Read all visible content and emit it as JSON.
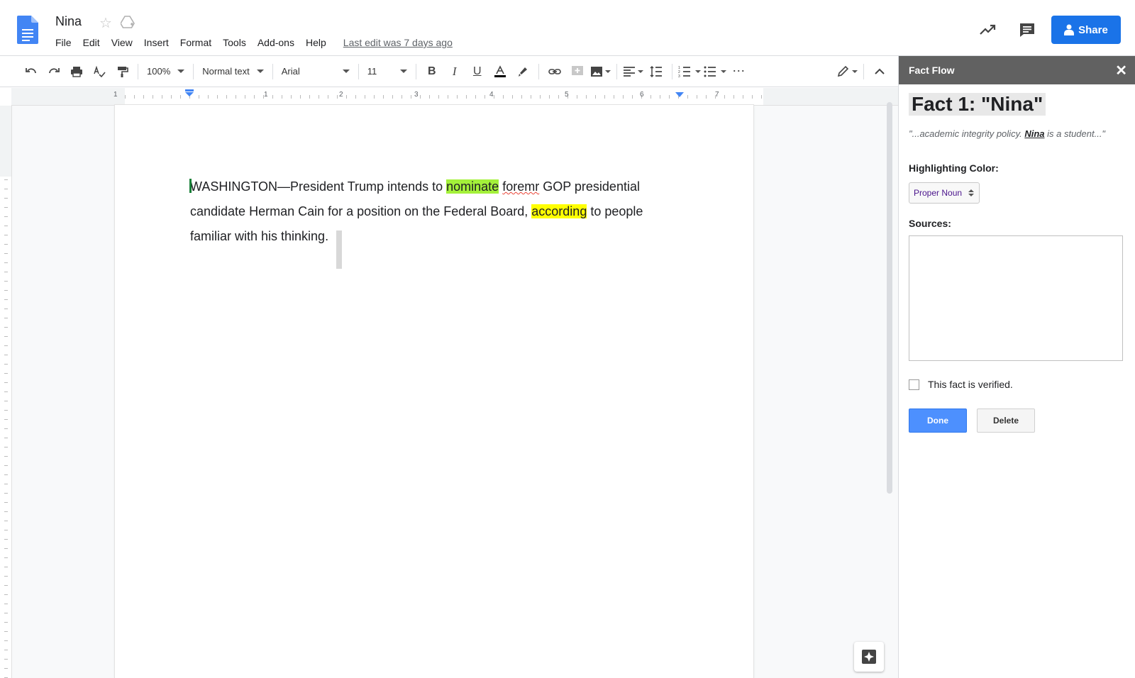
{
  "header": {
    "title": "Nina",
    "menu": [
      "File",
      "Edit",
      "View",
      "Insert",
      "Format",
      "Tools",
      "Add-ons",
      "Help"
    ],
    "last_edit": "Last edit was 7 days ago",
    "share_label": "Share"
  },
  "toolbar": {
    "zoom": "100%",
    "style": "Normal text",
    "font": "Arial",
    "size": "11"
  },
  "ruler": {
    "numbers": [
      "1",
      "1",
      "2",
      "3",
      "4",
      "5",
      "6",
      "7"
    ]
  },
  "document": {
    "p1": "WASHINGTON—President Trump intends to ",
    "hl1": "nominate",
    "p2": " ",
    "misspelled": "foremr",
    "p3": " GOP presidential candidate Herman Cain for a position on the Federal Board, ",
    "hl2": "according",
    "p4": " to people familiar with his thinking.",
    "hl1_color": "#a4f13a",
    "hl2_color": "#ffff00"
  },
  "sidebar": {
    "title": "Fact Flow",
    "fact_heading": "Fact 1: \"Nina\"",
    "quote_before": "\"...academic integrity policy. ",
    "quote_bold": "Nina",
    "quote_after": " is a student...\"",
    "highlight_label": "Highlighting Color:",
    "highlight_value": "Proper Noun",
    "sources_label": "Sources:",
    "sources_value": "",
    "verified_label": "This fact is verified.",
    "done_label": "Done",
    "delete_label": "Delete"
  },
  "colors": {
    "share": "#1a73e8",
    "sidebar_header": "#616161",
    "done_button": "#4d90fe"
  }
}
